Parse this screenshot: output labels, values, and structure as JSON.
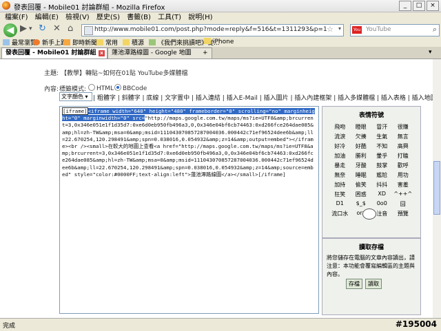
{
  "window": {
    "title": "發表回覆 - Mobile01 討論群組 - Mozilla Firefox"
  },
  "menu": [
    "檔案(F)",
    "編輯(E)",
    "檢視(V)",
    "歷史(S)",
    "書籤(B)",
    "工具(T)",
    "說明(H)"
  ],
  "address": {
    "url": "http://www.mobile01.com/post.php?mode=reply&f=516&t=1311293&p=1"
  },
  "search": {
    "placeholder": "YouTube"
  },
  "bookmarks": [
    "最常瀏覽",
    "新手上路",
    "即時新聞",
    "常用",
    "積源",
    "《我們來挑讀吧》從...",
    "iPhone"
  ],
  "tabs": [
    "發表回覆 - Mobile01 討論群組",
    "蓮池潭路線圖 - Google 地圖"
  ],
  "form": {
    "subject_label": "主題:",
    "subject_value": "【教學】轉貼~如何在01貼 YouTube多媒體檔",
    "content_label": "內容:",
    "mode_label": "標籤模式:",
    "mode_html": "HTML",
    "mode_bbcode": "BBCode",
    "font_color": "文字顏色",
    "toolbar": "| 粗體字 | 斜體字 | 底線 | 文字置中 | 插入連結 | 插入E-Mail | 插入圖片 | 插入內建框架 | 插入多媒體檔 | 插入表格 | 插入地圖",
    "editor_tag": "[iframe]",
    "editor_selected": "<iframe width=\"640\" height=\"480\" frameborder=\"0\" scrolling=\"no\" marginheight=\"0\" marginwidth=\"0\" src=",
    "editor_rest": "\"http://maps.google.com.tw/maps/ms?ie=UTF8&amp;brcurrent=3,0x346e051e1f1d35d7:0xe6d0eb950fb496a3,0,0x346e04bf6cb74463:0xd266fce264dae085&amp;hl=zh-TW&amp;msa=0&amp;msid=111043070857287004036.000442c71ef96524dee6b&amp;ll=22.670254,120.298491&amp;spn=0.038016,0.054932&amp;z=14&amp;output=embed\"></iframe><br /><small>在較大的地圖上查看<a href=\"http://maps.google.com.tw/maps/ms?ie=UTF8&amp;brcurrent=3,0x346e051e1f1d35d7:0xe6d0eb950fb496a3,0,0x346e04bf6cb74463:0xd266fce264dae085&amp;hl=zh-TW&amp;msa=0&amp;msid=111043070857287004036.000442c71ef96524dee6b&amp;ll=22.670254,120.298491&amp;spn=0.038016,0.054932&amp;z=14&amp;source=embed\" style=\"color:#0000FF;text-align:left\">蓮池潭路線圖</a></small>[/iframe]"
  },
  "emoticons": {
    "title": "表情符號",
    "items": [
      "飛吻",
      "瞪眼",
      "冒汗",
      "很賺",
      "流淚",
      "欠揍",
      "生氣",
      "無言",
      "好冷",
      "好酷",
      "不知",
      "高興",
      "加油",
      "勝利",
      "暈乎",
      "打瞌",
      "暴走",
      "牙酸",
      "鼓掌",
      "歡呼",
      "無奈",
      "睡眠",
      "尷尬",
      "用功",
      "加持",
      "偷笑",
      "抖抖",
      "害羞",
      "狂笑",
      "困惑",
      "XD",
      "^++^",
      "D1",
      "$_$",
      "0o0",
      "囧",
      "流口水",
      "orz",
      "注音",
      "預覽"
    ]
  },
  "draft": {
    "title": "讀取存檔",
    "text": "將您儲存在電腦的文章內容讀出，請注意：本功能會覆寫編輯區的主題與內容。",
    "save": "存檔",
    "load": "讀取"
  },
  "status": {
    "text": "完成",
    "caption": "#195004"
  }
}
